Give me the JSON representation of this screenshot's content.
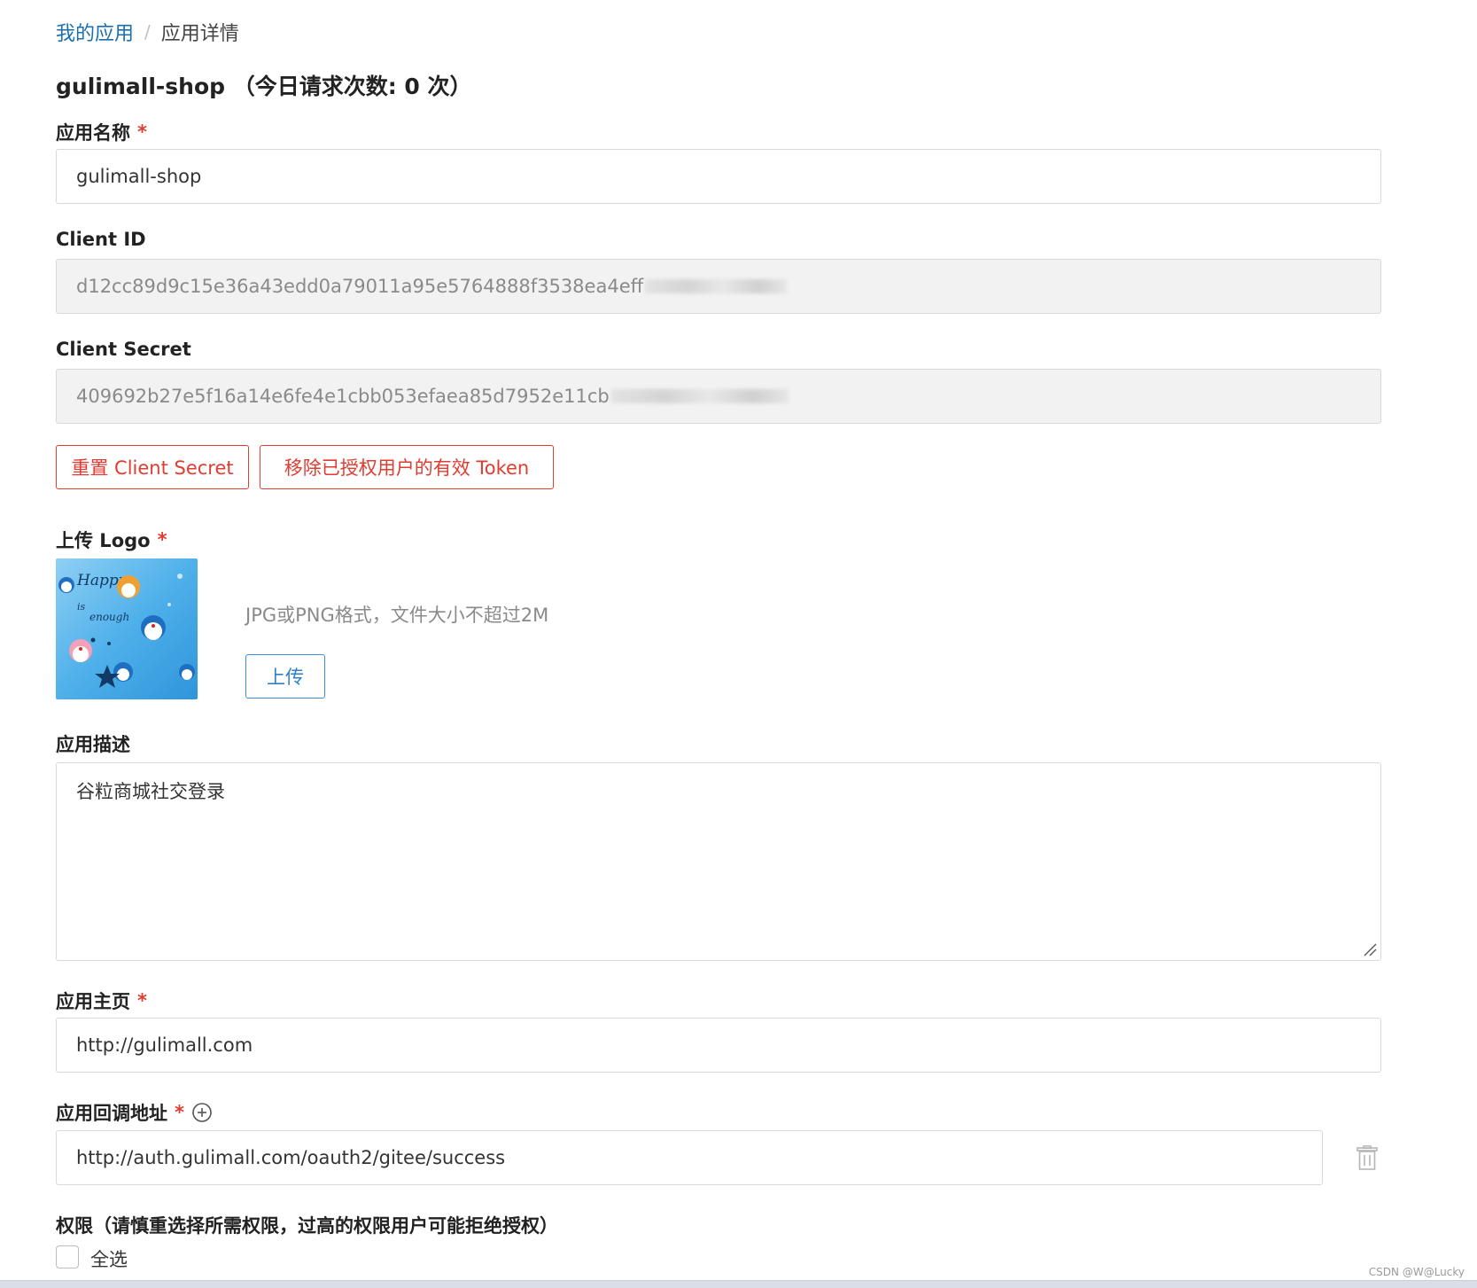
{
  "breadcrumb": {
    "link": "我的应用",
    "separator": "/",
    "current": "应用详情"
  },
  "page_title": "gulimall-shop （今日请求次数: 0 次）",
  "form": {
    "app_name": {
      "label": "应用名称",
      "required": "*",
      "value": "gulimall-shop"
    },
    "client_id": {
      "label": "Client ID",
      "value_visible": "d12cc89d9c15e36a43edd0a79011a95e5764888f3538ea4eff"
    },
    "client_secret": {
      "label": "Client Secret",
      "value_visible": "409692b27e5f16a14e6fe4e1cbb053efaea85d7952e11cb"
    },
    "buttons": {
      "reset_secret": "重置 Client Secret",
      "revoke_tokens": "移除已授权用户的有效 Token"
    },
    "logo": {
      "label": "上传 Logo",
      "required": "*",
      "hint": "JPG或PNG格式，文件大小不超过2M",
      "upload_button": "上传",
      "image_text": {
        "line1": "Happy",
        "line2": "is",
        "line3": "enough"
      }
    },
    "description": {
      "label": "应用描述",
      "value": "谷粒商城社交登录"
    },
    "homepage": {
      "label": "应用主页",
      "required": "*",
      "value": "http://gulimall.com"
    },
    "callback": {
      "label": "应用回调地址",
      "required": "*",
      "value": "http://auth.gulimall.com/oauth2/gitee/success"
    },
    "permissions": {
      "label": "权限（请慎重选择所需权限，过高的权限用户可能拒绝授权）",
      "select_all": "全选"
    }
  },
  "watermark": "CSDN @W@Lucky",
  "colors": {
    "link": "#1a6fb3",
    "danger": "#e03c31",
    "primary": "#3b8fd6",
    "readonly_bg": "#f2f2f2",
    "border": "#d9d9d9"
  },
  "icons": [
    "plus-circle-icon",
    "trash-icon",
    "resize-handle-icon"
  ]
}
